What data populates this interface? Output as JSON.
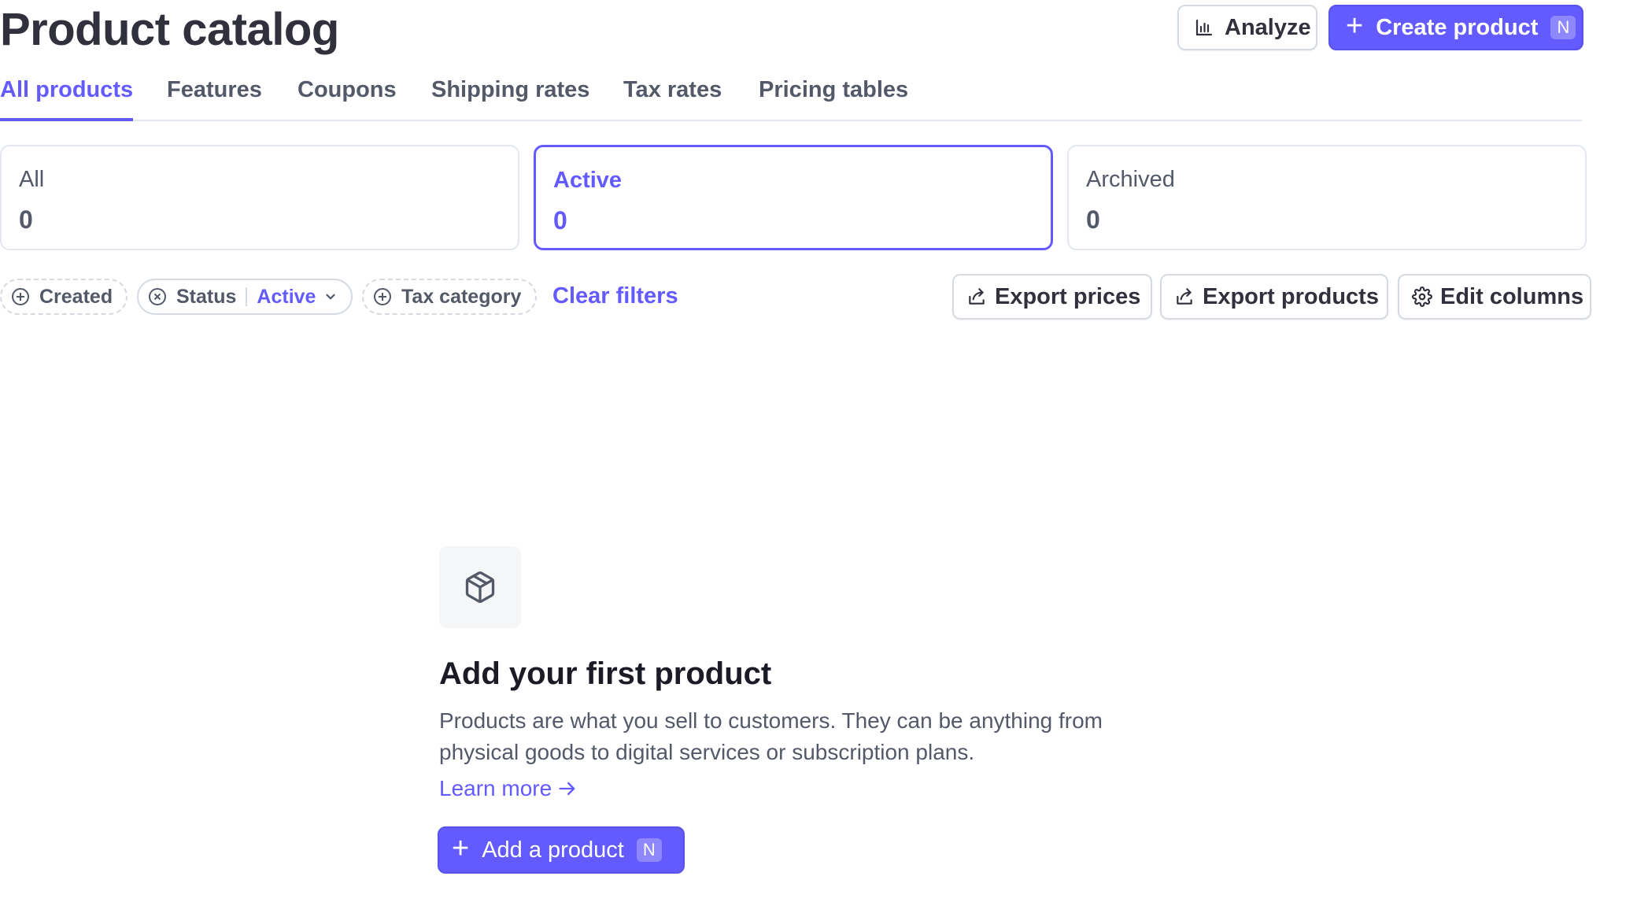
{
  "header": {
    "title": "Product catalog",
    "analyze_label": "Analyze",
    "analyze_icon": "bar-chart-icon",
    "create_label": "Create product",
    "create_shortcut": "N"
  },
  "tabs": [
    {
      "label": "All products",
      "active": true
    },
    {
      "label": "Features",
      "active": false
    },
    {
      "label": "Coupons",
      "active": false
    },
    {
      "label": "Shipping rates",
      "active": false
    },
    {
      "label": "Tax rates",
      "active": false
    },
    {
      "label": "Pricing tables",
      "active": false
    }
  ],
  "status_cards": [
    {
      "label": "All",
      "value": "0",
      "selected": false
    },
    {
      "label": "Active",
      "value": "0",
      "selected": true
    },
    {
      "label": "Archived",
      "value": "0",
      "selected": false
    }
  ],
  "filters": {
    "created_label": "Created",
    "status_label": "Status",
    "status_value": "Active",
    "tax_category_label": "Tax category",
    "clear_label": "Clear filters"
  },
  "actions": {
    "export_prices": "Export prices",
    "export_products": "Export products",
    "edit_columns": "Edit columns"
  },
  "empty_state": {
    "icon": "box-icon",
    "title": "Add your first product",
    "description": "Products are what you sell to customers. They can be anything from physical goods to digital services or subscription plans.",
    "learn_more": "Learn more",
    "add_label": "Add a product",
    "add_shortcut": "N"
  },
  "colors": {
    "accent": "#635bff",
    "text_muted": "#545969",
    "border": "#d5dbe1"
  }
}
